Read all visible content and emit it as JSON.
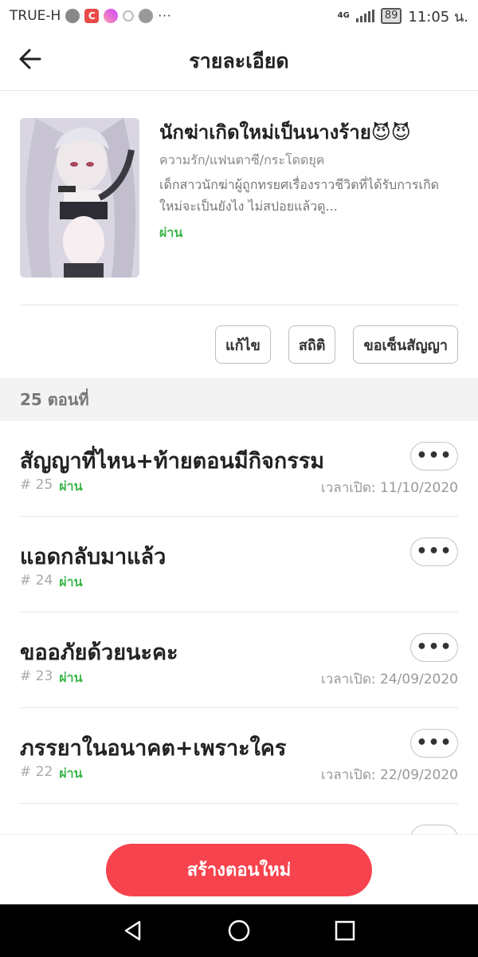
{
  "status_bar": {
    "carrier": "TRUE-H",
    "app_badge": "C",
    "overflow": "···",
    "network": "4G",
    "battery": "89",
    "time": "11:05 น."
  },
  "header": {
    "title": "รายละเอียด"
  },
  "novel": {
    "title": "นักฆ่าเกิดใหม่เป็นนางร้าย😈😈",
    "genres": "ความรัก/แฟนตาซี/กระโดดยุค",
    "description": "เด็กสาวนักฆ่าผู้ถูกทรยศเรื่องราวชีวิตที่ได้รับการเกิดใหม่จะเป็นยังไง  ไม่สปอยแล้วดู...",
    "status": "ผ่าน"
  },
  "actions": {
    "edit": "แก้ไข",
    "stats": "สถิติ",
    "contract": "ขอเซ็นสัญญา"
  },
  "episodes_count_label": "25 ตอนที่",
  "episodes": [
    {
      "title": "สัญญาที่ไหน+ท้ายตอนมีกิจกรรม",
      "number": "# 25",
      "status": "ผ่าน",
      "date": "เวลาเปิด: 11/10/2020",
      "more": "•••"
    },
    {
      "title": "แอดกลับมาแล้ว",
      "number": "# 24",
      "status": "ผ่าน",
      "date": "",
      "more": "•••"
    },
    {
      "title": "ขออภัยด้วยนะคะ",
      "number": "# 23",
      "status": "ผ่าน",
      "date": "เวลาเปิด: 24/09/2020",
      "more": "•••"
    },
    {
      "title": "ภรรยาในอนาคต+เพราะใคร",
      "number": "# 22",
      "status": "ผ่าน",
      "date": "เวลาเปิด: 22/09/2020",
      "more": "•••"
    },
    {
      "title": "",
      "number": "",
      "status": "",
      "date": "",
      "more": "•••"
    }
  ],
  "bottom": {
    "create_label": "สร้างตอนใหม่"
  },
  "colors": {
    "accent": "#f7434d",
    "pass_green": "#3bb64a"
  },
  "icons": {
    "back": "arrow-left-icon",
    "nav_back": "triangle-back-icon",
    "nav_home": "circle-home-icon",
    "nav_recent": "square-recent-icon"
  }
}
